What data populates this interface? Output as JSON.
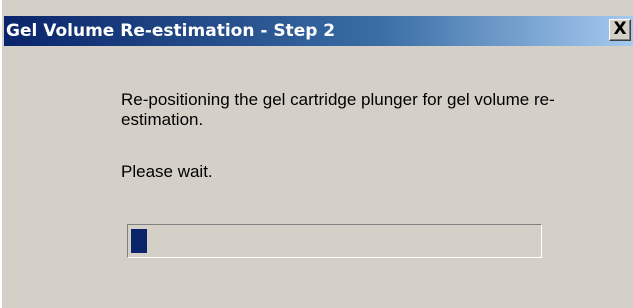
{
  "window": {
    "title": "Gel Volume Re-estimation - Step 2",
    "close_symbol": "X"
  },
  "dialog": {
    "message": "Re-positioning the gel cartridge plunger for gel volume re-estimation.",
    "wait_text": "Please wait.",
    "progress_fraction": 0.04
  },
  "colors": {
    "titlebar_start": "#0a246a",
    "titlebar_end": "#a6caf0",
    "dialog_background": "#d4d0c8",
    "progress_fill": "#0a246a"
  },
  "icons": {
    "close": "close-icon"
  }
}
